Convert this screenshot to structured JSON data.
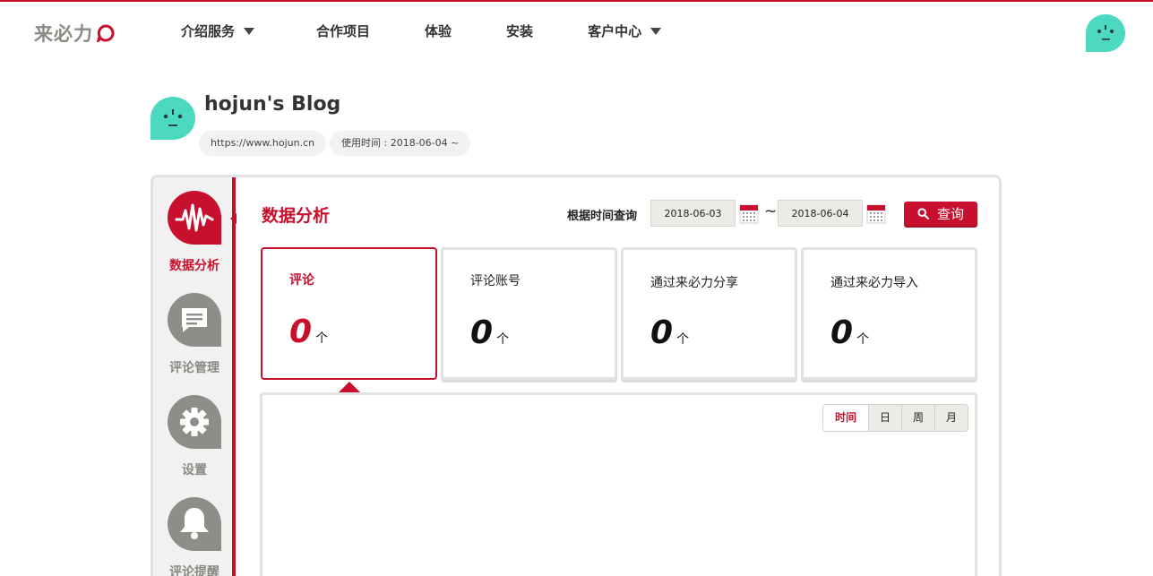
{
  "brand": {
    "logo_text": "来必力",
    "accent": "#c8102e",
    "mint": "#4dd8c0"
  },
  "nav": {
    "items": [
      {
        "label": "介绍服务",
        "dropdown": true
      },
      {
        "label": "合作项目",
        "dropdown": false
      },
      {
        "label": "体验",
        "dropdown": false
      },
      {
        "label": "安装",
        "dropdown": false
      },
      {
        "label": "客户中心",
        "dropdown": true
      }
    ]
  },
  "profile": {
    "title": "hojun's Blog",
    "url": "https://www.hojun.cn",
    "usage": "使用时间 : 2018-06-04 ~"
  },
  "sidebar": {
    "items": [
      {
        "label": "数据分析",
        "icon": "waveform-icon",
        "active": true
      },
      {
        "label": "评论管理",
        "icon": "comment-icon",
        "active": false
      },
      {
        "label": "设置",
        "icon": "gear-icon",
        "active": false
      },
      {
        "label": "评论提醒",
        "icon": "bell-icon",
        "active": false
      }
    ]
  },
  "main": {
    "section_title": "数据分析",
    "query_label": "根据时间查询",
    "date_from": "2018-06-03",
    "date_to": "2018-06-04",
    "tilde": "~",
    "search_label": "查询",
    "stats": [
      {
        "label": "评论",
        "value": "0",
        "unit": "个",
        "active": true
      },
      {
        "label": "评论账号",
        "value": "0",
        "unit": "个",
        "active": false
      },
      {
        "label": "通过来必力分享",
        "value": "0",
        "unit": "个",
        "active": false
      },
      {
        "label": "通过来必力导入",
        "value": "0",
        "unit": "个",
        "active": false
      }
    ],
    "period_tabs": [
      {
        "label": "时间",
        "active": true
      },
      {
        "label": "日",
        "active": false
      },
      {
        "label": "周",
        "active": false
      },
      {
        "label": "月",
        "active": false
      }
    ]
  }
}
